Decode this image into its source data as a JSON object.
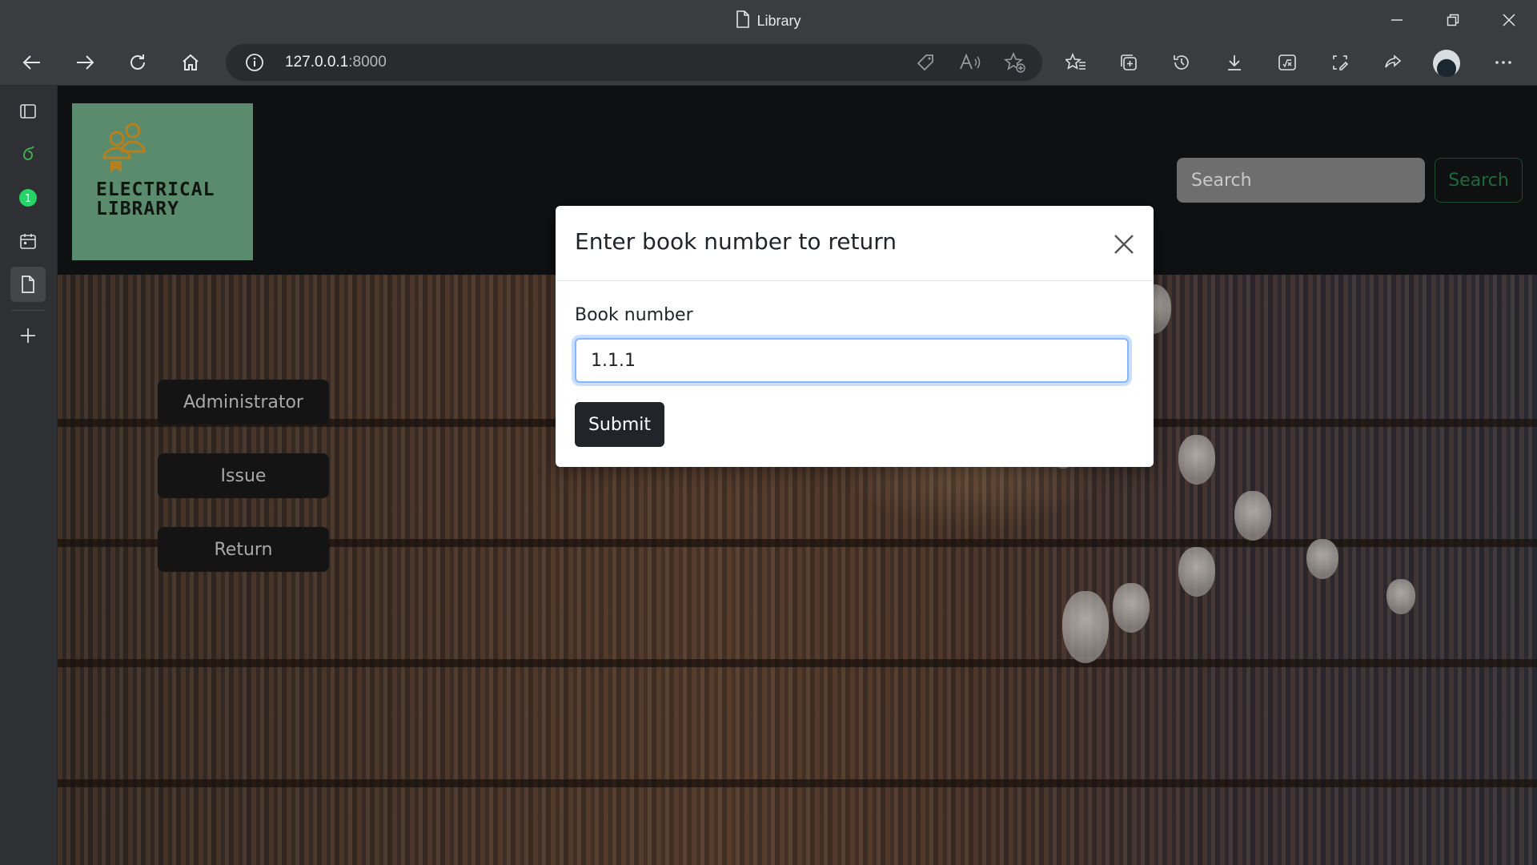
{
  "window": {
    "tab_title": "Library"
  },
  "address": {
    "host": "127.0.0.1",
    "port": ":8000"
  },
  "logo": {
    "line1": "ELECTRICAL",
    "line2": "LIBRARY"
  },
  "header": {
    "search_placeholder": "Search",
    "search_button": "Search"
  },
  "menu": {
    "items": [
      {
        "label": "Administrator"
      },
      {
        "label": "Issue"
      },
      {
        "label": "Return"
      }
    ]
  },
  "modal": {
    "title": "Enter book number to return",
    "field_label": "Book number",
    "field_value": "1.1.1",
    "submit_label": "Submit"
  },
  "colors": {
    "logo_bg": "#5a8b6d",
    "search_button_border": "#1c4d2e",
    "submit_bg": "#212529",
    "input_focus": "#86b7fe"
  }
}
